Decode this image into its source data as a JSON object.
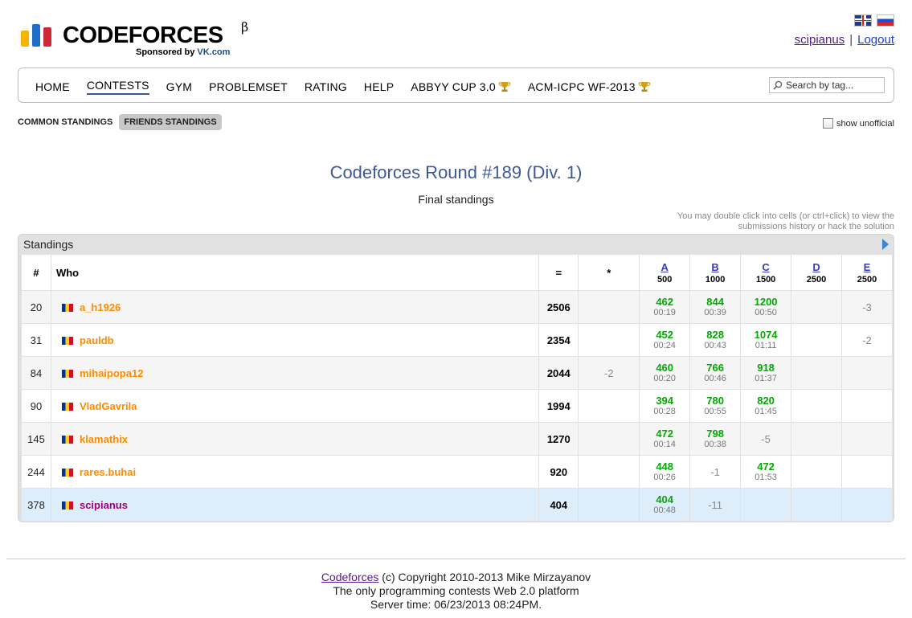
{
  "logo": {
    "wordmark": "CODEFORCES",
    "beta": "β",
    "sponsor_prefix": "Sponsored by",
    "sponsor_name": "VK.com"
  },
  "header": {
    "username": "scipianus",
    "separator": "|",
    "logout": "Logout",
    "languages": [
      "english-flag",
      "russian-flag"
    ]
  },
  "menu": {
    "items": [
      "HOME",
      "CONTESTS",
      "GYM",
      "PROBLEMSET",
      "RATING",
      "HELP",
      "ABBYY CUP 3.0",
      "ACM-ICPC WF-2013"
    ],
    "active": "CONTESTS",
    "search_placeholder": "Search by tag..."
  },
  "tabs": {
    "common": "COMMON STANDINGS",
    "friends": "FRIENDS STANDINGS",
    "show_unofficial": "show unofficial"
  },
  "contest": {
    "title": "Codeforces Round #189 (Div. 1)",
    "subtitle": "Final standings",
    "hint_line1": "You may double click into cells (or ctrl+click) to view the",
    "hint_line2": "submissions history or hack the solution"
  },
  "standings": {
    "caption": "Standings",
    "headers": {
      "rank": "#",
      "who": "Who",
      "score": "=",
      "hacks": "*",
      "problems": [
        {
          "letter": "A",
          "points": "500"
        },
        {
          "letter": "B",
          "points": "1000"
        },
        {
          "letter": "C",
          "points": "1500"
        },
        {
          "letter": "D",
          "points": "2500"
        },
        {
          "letter": "E",
          "points": "2500"
        }
      ]
    },
    "rows": [
      {
        "rank": "20",
        "handle": "a_h1926",
        "score": "2506",
        "hacks": "",
        "cells": [
          [
            "462",
            "00:19"
          ],
          [
            "844",
            "00:39"
          ],
          [
            "1200",
            "00:50"
          ],
          "",
          "-3"
        ]
      },
      {
        "rank": "31",
        "handle": "pauldb",
        "score": "2354",
        "hacks": "",
        "cells": [
          [
            "452",
            "00:24"
          ],
          [
            "828",
            "00:43"
          ],
          [
            "1074",
            "01:11"
          ],
          "",
          "-2"
        ]
      },
      {
        "rank": "84",
        "handle": "mihaipopa12",
        "score": "2044",
        "hacks": "-2",
        "cells": [
          [
            "460",
            "00:20"
          ],
          [
            "766",
            "00:46"
          ],
          [
            "918",
            "01:37"
          ],
          "",
          ""
        ]
      },
      {
        "rank": "90",
        "handle": "VladGavrila",
        "score": "1994",
        "hacks": "",
        "cells": [
          [
            "394",
            "00:28"
          ],
          [
            "780",
            "00:55"
          ],
          [
            "820",
            "01:45"
          ],
          "",
          ""
        ]
      },
      {
        "rank": "145",
        "handle": "klamathix",
        "score": "1270",
        "hacks": "",
        "cells": [
          [
            "472",
            "00:14"
          ],
          [
            "798",
            "00:38"
          ],
          "-5",
          "",
          ""
        ]
      },
      {
        "rank": "244",
        "handle": "rares.buhai",
        "score": "920",
        "hacks": "",
        "cells": [
          [
            "448",
            "00:26"
          ],
          "-1",
          [
            "472",
            "01:53"
          ],
          "",
          ""
        ]
      },
      {
        "rank": "378",
        "handle": "scipianus",
        "score": "404",
        "hacks": "",
        "cells": [
          [
            "404",
            "00:48"
          ],
          "-11",
          "",
          "",
          ""
        ],
        "me": true
      }
    ]
  },
  "footer": {
    "link": "Codeforces",
    "copyright": " (c) Copyright 2010-2013 Mike Mirzayanov",
    "tagline": "The only programming contests Web 2.0 platform",
    "server_time": "Server time: 06/23/2013 08:24PM."
  },
  "colors": {
    "accepted": "#00aa00",
    "rejected": "#888888",
    "handle_orange": "#ff8c00",
    "handle_me": "#a0007e",
    "title_blue": "#3b5998",
    "highlight_row": "#ddeefa"
  }
}
